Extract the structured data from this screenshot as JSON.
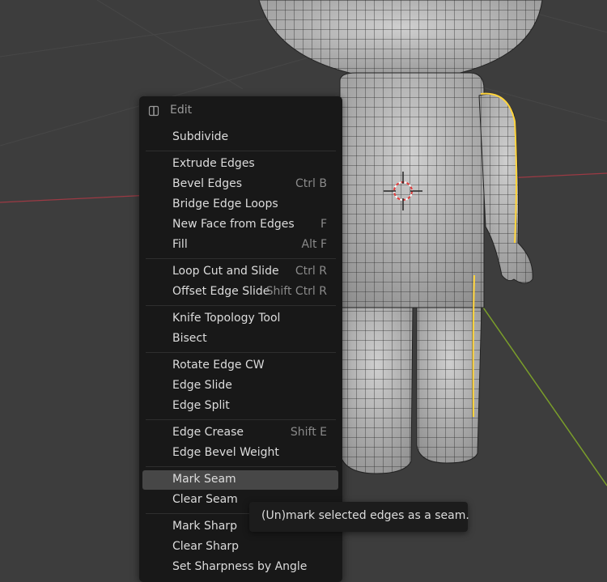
{
  "menu": {
    "title": "Edit",
    "groups": [
      [
        {
          "label": "Subdivide",
          "shortcut": ""
        }
      ],
      [
        {
          "label": "Extrude Edges",
          "shortcut": ""
        },
        {
          "label": "Bevel Edges",
          "shortcut": "Ctrl B"
        },
        {
          "label": "Bridge Edge Loops",
          "shortcut": ""
        },
        {
          "label": "New Face from Edges",
          "shortcut": "F"
        },
        {
          "label": "Fill",
          "shortcut": "Alt F"
        }
      ],
      [
        {
          "label": "Loop Cut and Slide",
          "shortcut": "Ctrl R"
        },
        {
          "label": "Offset Edge Slide",
          "shortcut": "Shift Ctrl R"
        }
      ],
      [
        {
          "label": "Knife Topology Tool",
          "shortcut": ""
        },
        {
          "label": "Bisect",
          "shortcut": ""
        }
      ],
      [
        {
          "label": "Rotate Edge CW",
          "shortcut": ""
        },
        {
          "label": "Edge Slide",
          "shortcut": ""
        },
        {
          "label": "Edge Split",
          "shortcut": ""
        }
      ],
      [
        {
          "label": "Edge Crease",
          "shortcut": "Shift E"
        },
        {
          "label": "Edge Bevel Weight",
          "shortcut": ""
        }
      ],
      [
        {
          "label": "Mark Seam",
          "shortcut": "",
          "active": true
        },
        {
          "label": "Clear Seam",
          "shortcut": ""
        }
      ],
      [
        {
          "label": "Mark Sharp",
          "shortcut": ""
        },
        {
          "label": "Clear Sharp",
          "shortcut": ""
        },
        {
          "label": "Set Sharpness by Angle",
          "shortcut": ""
        }
      ]
    ]
  },
  "tooltip": {
    "text": "(Un)mark selected edges as a seam."
  },
  "colors": {
    "viewport_bg": "#3d3d3d",
    "menu_bg": "#181818",
    "highlight": "#474747",
    "selected_edge": "#ffd43b",
    "x_axis": "#9c3a44",
    "y_axis": "#7a9e2a"
  }
}
